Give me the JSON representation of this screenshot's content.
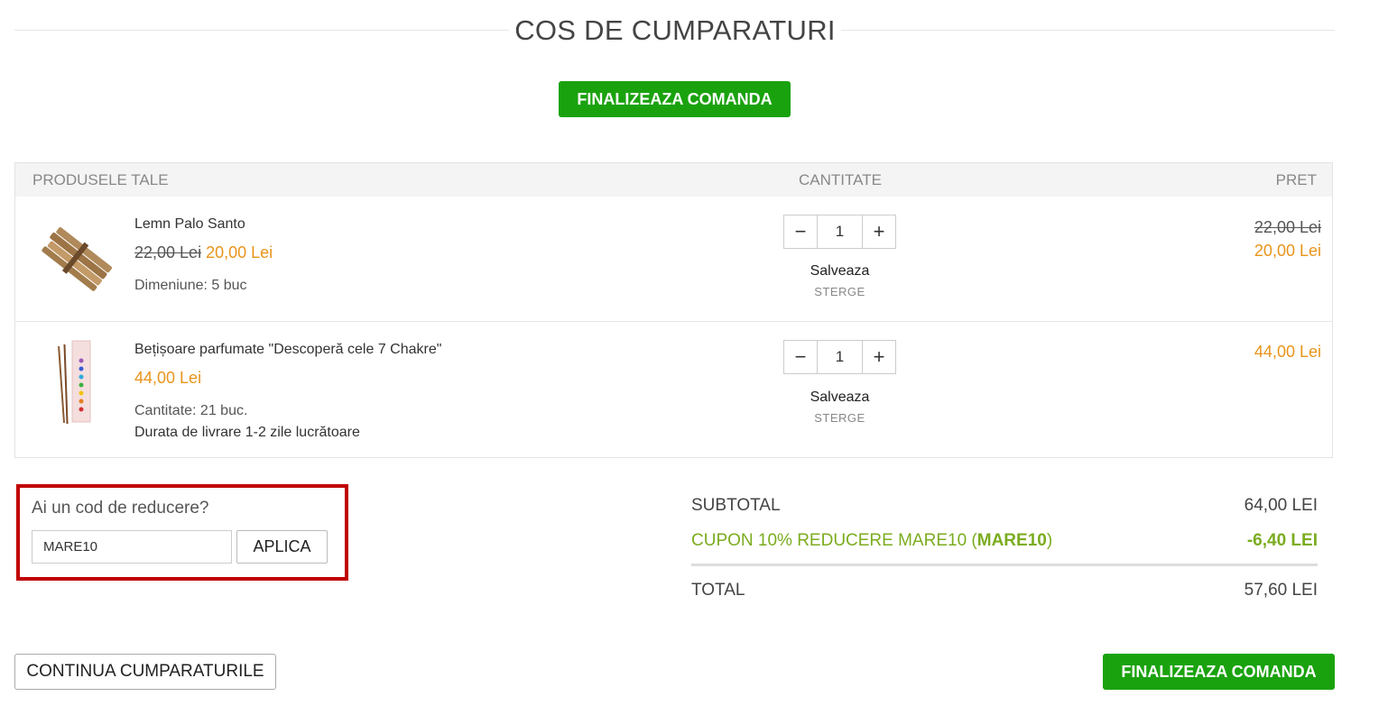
{
  "page": {
    "title": "COS DE CUMPARATURI"
  },
  "actions": {
    "checkout_top": "FINALIZEAZA COMANDA",
    "checkout_bottom": "FINALIZEAZA COMANDA",
    "continue_shopping": "CONTINUA CUMPARATURILE"
  },
  "table": {
    "headers": {
      "products": "PRODUSELE TALE",
      "quantity": "CANTITATE",
      "price": "PRET"
    }
  },
  "items": [
    {
      "name": "Lemn Palo Santo",
      "old_price": "22,00 Lei",
      "price": "20,00 Lei",
      "attr1": "Dimeniune: 5 buc",
      "attr2": "",
      "qty": "1",
      "save": "Salveaza",
      "delete": "STERGE",
      "line_old": "22,00 Lei",
      "line_price": "20,00 Lei",
      "image": "palo-santo-sticks"
    },
    {
      "name": "Bețișoare parfumate \"Descoperă cele 7 Chakre\"",
      "old_price": "",
      "price": "44,00 Lei",
      "attr1": "Cantitate: 21 buc.",
      "attr2": "Durata de livrare 1-2 zile lucrătoare",
      "qty": "1",
      "save": "Salveaza",
      "delete": "STERGE",
      "line_old": "",
      "line_price": "44,00 Lei",
      "image": "chakra-incense-box"
    }
  ],
  "coupon": {
    "label": "Ai un cod de reducere?",
    "value": "MARE10",
    "apply": "APLICA",
    "highlight_color": "#c00000"
  },
  "totals": {
    "subtotal_label": "SUBTOTAL",
    "subtotal_value": "64,00 LEI",
    "coupon_label_prefix": "CUPON 10% REDUCERE MARE10 (",
    "coupon_code": "MARE10",
    "coupon_label_suffix": ")",
    "coupon_value": "-6,40 LEI",
    "total_label": "TOTAL",
    "total_value": "57,60 LEI"
  },
  "colors": {
    "accent_green": "#1aa20e",
    "price_orange": "#e8941a",
    "coupon_green": "#7bac1f"
  }
}
